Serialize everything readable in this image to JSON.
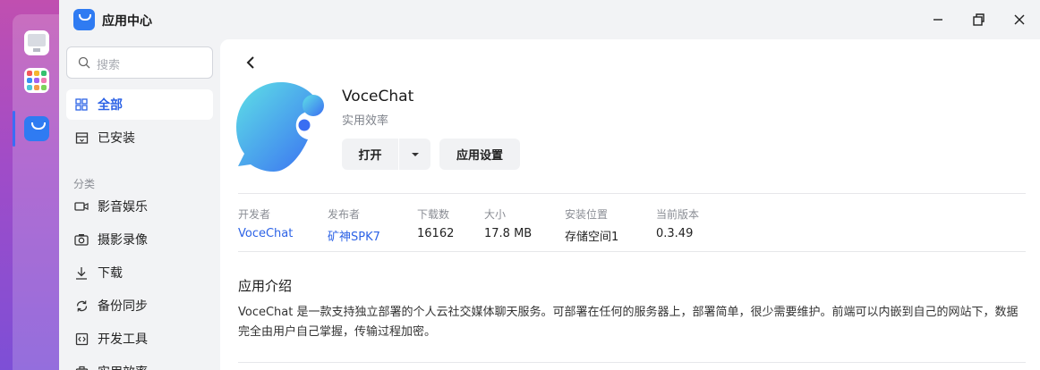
{
  "window": {
    "title": "应用中心"
  },
  "colors": {
    "accent": "#2d63e6",
    "dock_top": "#c04fb0",
    "dock_bottom": "#7d4fd6"
  },
  "sidebar": {
    "search_placeholder": "搜索",
    "items": [
      {
        "label": "全部",
        "icon": "grid-icon",
        "active": true
      },
      {
        "label": "已安装",
        "icon": "installed-box-icon",
        "active": false
      }
    ],
    "section_label": "分类",
    "categories": [
      {
        "label": "影音娱乐",
        "icon": "video-camera-icon"
      },
      {
        "label": "摄影录像",
        "icon": "camera-icon"
      },
      {
        "label": "下载",
        "icon": "download-icon"
      },
      {
        "label": "备份同步",
        "icon": "sync-icon"
      },
      {
        "label": "开发工具",
        "icon": "code-icon"
      },
      {
        "label": "实用效率",
        "icon": "tools-icon"
      }
    ]
  },
  "app": {
    "name": "VoceChat",
    "category": "实用效率",
    "open_label": "打开",
    "settings_label": "应用设置",
    "info": [
      {
        "key": "开发者",
        "value": "VoceChat",
        "link": true
      },
      {
        "key": "发布者",
        "value": "矿神SPK7",
        "link": true
      },
      {
        "key": "下载数",
        "value": "16162",
        "link": false
      },
      {
        "key": "大小",
        "value": "17.8 MB",
        "link": false
      },
      {
        "key": "安装位置",
        "value": "存储空间1",
        "link": false
      },
      {
        "key": "当前版本",
        "value": "0.3.49",
        "link": false
      }
    ],
    "intro_title": "应用介绍",
    "intro_text": "VoceChat 是一款支持独立部署的个人云社交媒体聊天服务。可部署在任何的服务器上，部署简单，很少需要维护。前端可以内嵌到自己的网站下，数据完全由用户自己掌握，传输过程加密。"
  }
}
